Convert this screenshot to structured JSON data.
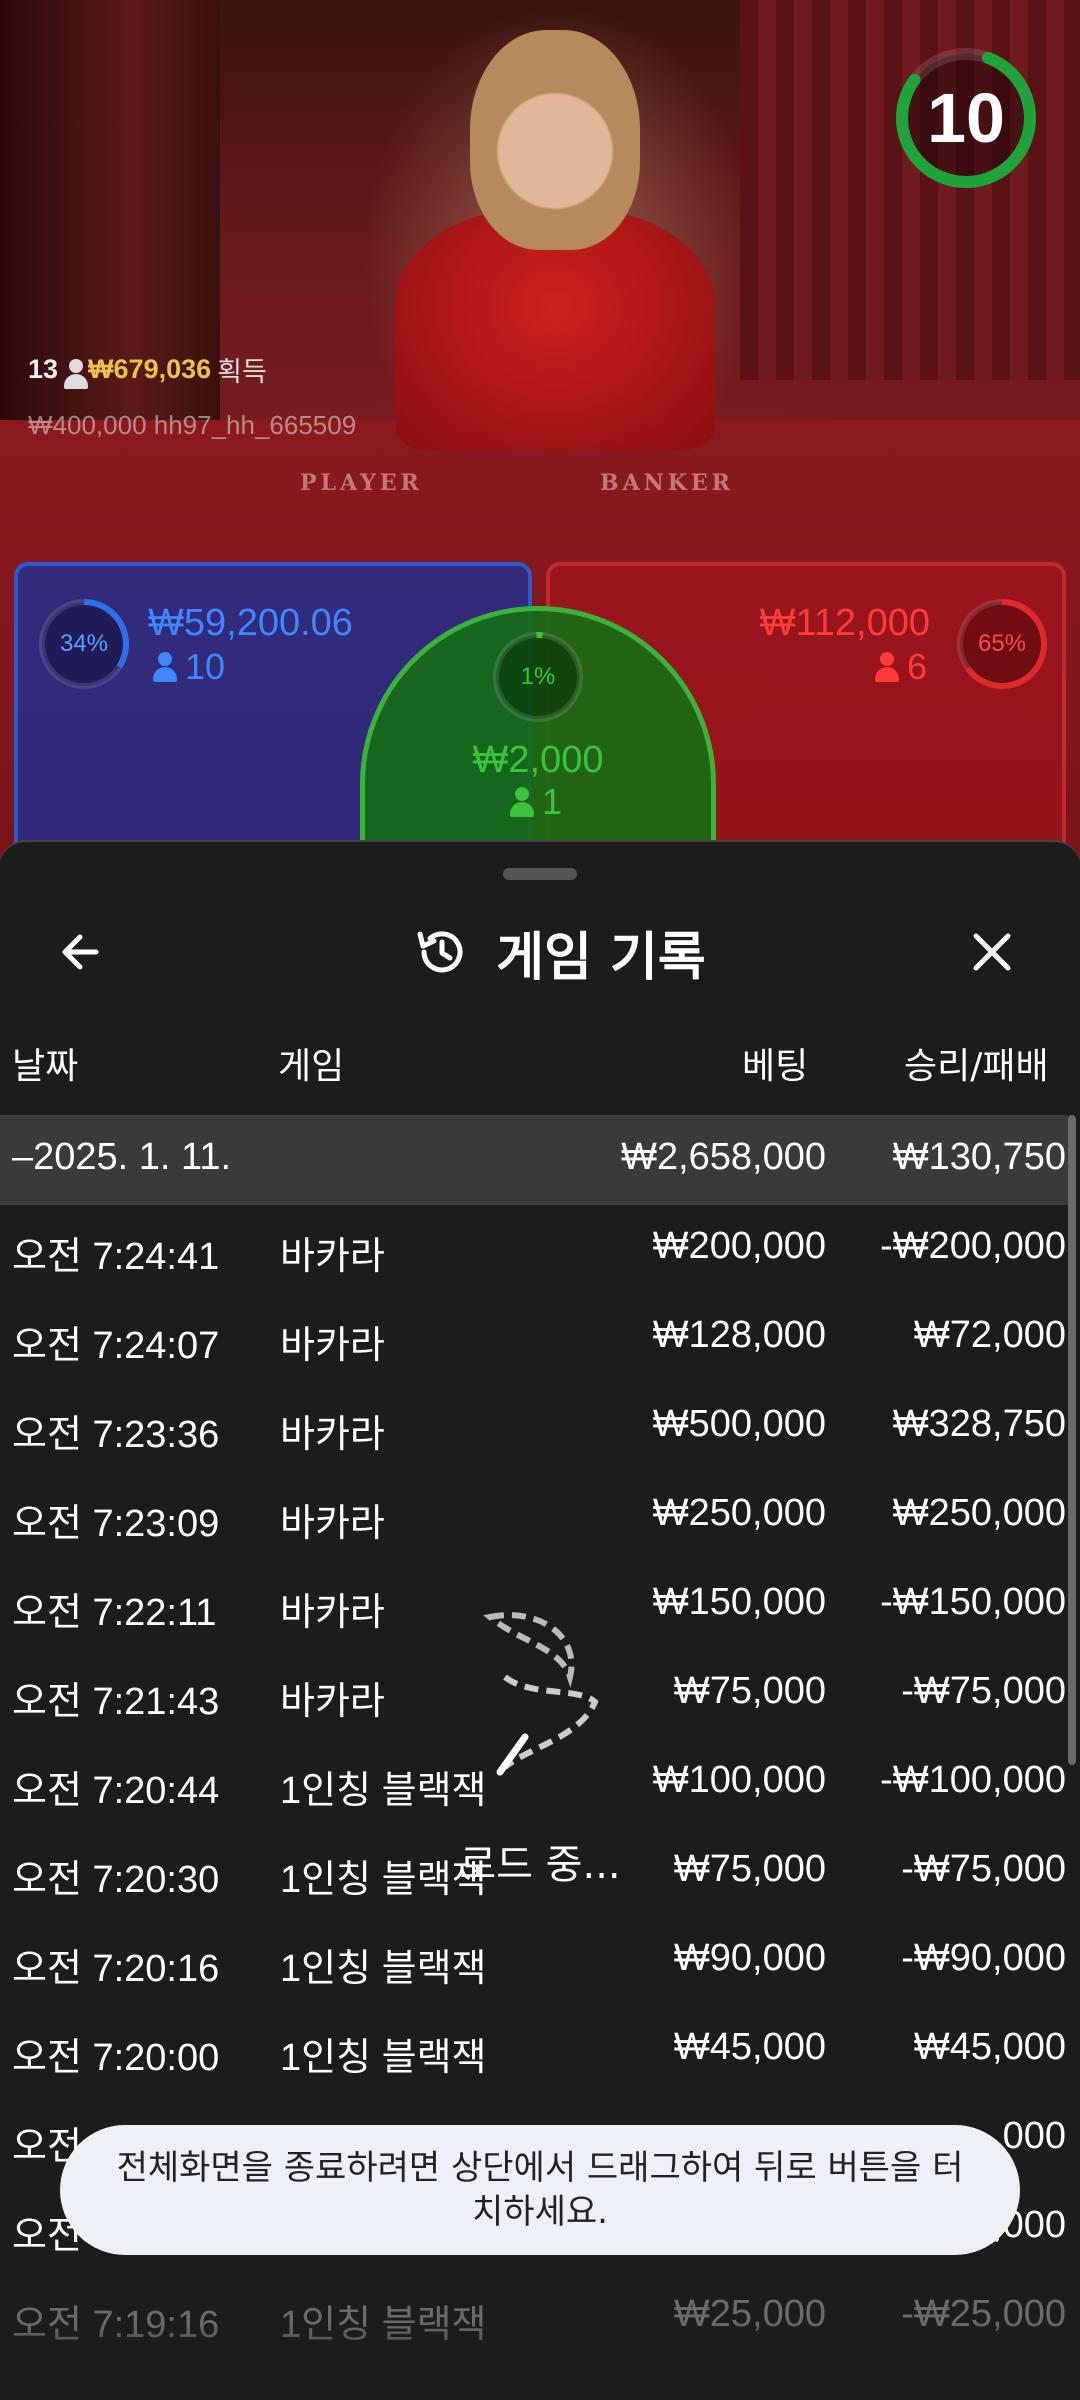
{
  "colors": {
    "player_blue": "#2f6fe8",
    "banker_red": "#e02a2a",
    "tie_green": "#3bc43b",
    "winner_gold": "#e8c34a",
    "timer_green": "#1fa33a",
    "sheet_bg": "#1c1c1c",
    "summary_row_bg": "#3a3a3a",
    "toast_bg": "#eef0f7"
  },
  "video": {
    "timer_value": "10",
    "winner": {
      "count": "13",
      "amount": "₩679,036",
      "label": "획득"
    },
    "winner_line2": "₩400,000  hh97_hh_665509",
    "table_words": {
      "player": "PLAYER",
      "banker": "BANKER"
    },
    "player_spot": {
      "percent": "34%",
      "amount": "₩59,200.06",
      "count": "10"
    },
    "tie_spot": {
      "percent": "1%",
      "amount": "₩2,000",
      "count": "1"
    },
    "banker_spot": {
      "percent": "65%",
      "amount": "₩112,000",
      "count": "6"
    }
  },
  "sheet": {
    "title": "게임 기록",
    "back_icon": "arrow-left-icon",
    "history_icon": "history-clock-icon",
    "close_icon": "close-icon",
    "columns": {
      "date": "날짜",
      "game": "게임",
      "bet": "베팅",
      "result": "승리/패배"
    },
    "summary": {
      "date": "–2025. 1. 11.",
      "bet": "₩2,658,000",
      "result": "₩130,750"
    },
    "rows": [
      {
        "time": "오전 7:24:41",
        "game": "바카라",
        "bet": "₩200,000",
        "result": "-₩200,000"
      },
      {
        "time": "오전 7:24:07",
        "game": "바카라",
        "bet": "₩128,000",
        "result": "₩72,000"
      },
      {
        "time": "오전 7:23:36",
        "game": "바카라",
        "bet": "₩500,000",
        "result": "₩328,750"
      },
      {
        "time": "오전 7:23:09",
        "game": "바카라",
        "bet": "₩250,000",
        "result": "₩250,000"
      },
      {
        "time": "오전 7:22:11",
        "game": "바카라",
        "bet": "₩150,000",
        "result": "-₩150,000"
      },
      {
        "time": "오전 7:21:43",
        "game": "바카라",
        "bet": "₩75,000",
        "result": "-₩75,000"
      },
      {
        "time": "오전 7:20:44",
        "game": "1인칭 블랙잭",
        "bet": "₩100,000",
        "result": "-₩100,000"
      },
      {
        "time": "오전 7:20:30",
        "game": "1인칭 블랙잭",
        "bet": "₩75,000",
        "result": "-₩75,000"
      },
      {
        "time": "오전 7:20:16",
        "game": "1인칭 블랙잭",
        "bet": "₩90,000",
        "result": "-₩90,000"
      },
      {
        "time": "오전 7:20:00",
        "game": "1인칭 블랙잭",
        "bet": "₩45,000",
        "result": "₩45,000"
      },
      {
        "time": "오전",
        "game": "",
        "bet": "",
        "result": "000"
      },
      {
        "time": "오전",
        "game": "",
        "bet": "",
        "result": ",000"
      },
      {
        "time": "오전 7:19:16",
        "game": "1인칭 블랙잭",
        "bet": "₩25,000",
        "result": "-₩25,000"
      }
    ],
    "loading_text": "로드 중...",
    "toast_text": "전체화면을 종료하려면 상단에서 드래그하여 뒤로 버튼을 터치하세요."
  }
}
